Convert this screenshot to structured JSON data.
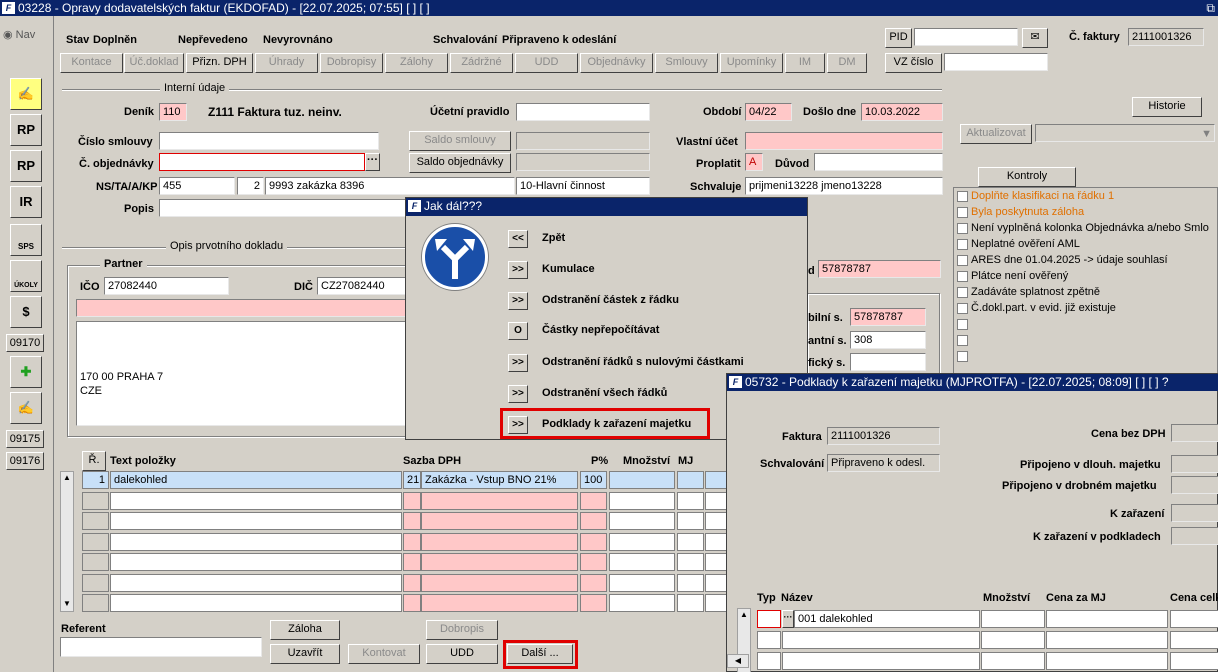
{
  "main_window": {
    "title": "03228 - Opravy dodavatelských faktur (EKDOFAD) - [22.07.2025; 07:55]  [ ]  [ ]",
    "restore_icon": "restore-icon"
  },
  "sidebar": {
    "nav_label": "Nav",
    "buttons": [
      {
        "label": "RP"
      },
      {
        "label": "RP"
      },
      {
        "label": "IR"
      },
      {
        "label": "SPS"
      },
      {
        "label": "ÚKOLY"
      },
      {
        "label": "09170"
      },
      {
        "label": "09175"
      },
      {
        "label": "09176"
      }
    ]
  },
  "status": {
    "stav_label": "Stav",
    "stav_value": "Doplněn",
    "prenes": "Nepřevedeno",
    "vyrovnano": "Nevyrovnáno",
    "schval_label": "Schvalování",
    "schval_value": "Připraveno k odeslání"
  },
  "tabs": [
    "Kontace",
    "Úč.doklad",
    "Přizn. DPH",
    "Úhrady",
    "Dobropisy",
    "Zálohy",
    "Zádržné",
    "UDD",
    "Objednávky",
    "Smlouvy",
    "Upomínky",
    "IM",
    "DM"
  ],
  "pid": {
    "label": "PID",
    "value": "",
    "vz_label": "VZ číslo",
    "vz_value": ""
  },
  "faktura": {
    "label": "Č. faktury",
    "value": "2111001326"
  },
  "internal": {
    "section": "Interní údaje",
    "denik_label": "Deník",
    "denik_value": "110",
    "denik_name": "Z111 Faktura tuz. neinv.",
    "ucet_label": "Účetní pravidlo",
    "ucet_value": "",
    "obdobi_label": "Období",
    "obdobi_value": "04/22",
    "doslo_label": "Došlo dne",
    "doslo_value": "10.03.2022",
    "historie": "Historie",
    "smlouva_label": "Číslo smlouvy",
    "smlouva_value": "",
    "saldo_smlouvy": "Saldo smlouvy",
    "vlastni_label": "Vlastní účet",
    "vlastni_value": "",
    "aktualizovat": "Aktualizovat",
    "obj_label": "Č. objednávky",
    "obj_value": "",
    "saldo_obj": "Saldo objednávky",
    "proplatit_label": "Proplatit",
    "proplatit_value": "A",
    "duvod_label": "Důvod",
    "duvod_value": "",
    "ns_label": "NS/TA/A/KP",
    "ns_value": "455",
    "ta_value": "2",
    "a_value": "9993 zakázka 8396",
    "kp_value": "10-Hlavní činnost",
    "schvaluje_label": "Schvaluje",
    "schvaluje_value": "prijmeni13228 jmeno13228",
    "popis_label": "Popis",
    "popis_value": ""
  },
  "kontroly": {
    "tab": "Kontroly",
    "items": [
      {
        "text": "Doplňte klasifikaci na řádku 1",
        "color": "#e07000"
      },
      {
        "text": "Byla poskytnuta záloha",
        "color": "#e07000"
      },
      {
        "text": "Není vyplněná kolonka Objednávka a/nebo Smlo",
        "color": "#000000"
      },
      {
        "text": "Neplatné ověření AML",
        "color": "#000000"
      },
      {
        "text": "ARES dne 01.04.2025 -> údaje souhlasí",
        "color": "#000000"
      },
      {
        "text": "Plátce není ověřený",
        "color": "#000000"
      },
      {
        "text": "Zadáváte splatnost zpětně",
        "color": "#000000"
      },
      {
        "text": "Č.dokl.part. v evid. již existuje",
        "color": "#000000"
      }
    ]
  },
  "opis": {
    "section": "Opis prvotního dokladu",
    "partner": "Partner",
    "ico_label": "IČO",
    "ico_value": "27082440",
    "dic_label": "DIČ",
    "dic_value": "CZ27082440",
    "addr_line1": "170 00 PRAHA 7",
    "addr_line2": "CZE",
    "vs_label": "d",
    "vs_value": "57878787",
    "ks_label": "bilní s.",
    "ks_value": "57878787",
    "kon_label": "antní s.",
    "kon_value": "308",
    "spec_label": "fický s.",
    "spec_value": ""
  },
  "items_table": {
    "headers": {
      "r": "Ř.",
      "text": "Text položky",
      "sazba": "Sazba DPH",
      "pct": "P%",
      "mnozstvi": "Množství",
      "mj": "MJ"
    },
    "rows": [
      {
        "r": "1",
        "text": "dalekohled",
        "sazba_code": "21",
        "sazba_text": "Zakázka - Vstup BNO 21%",
        "pct": "100",
        "mnozstvi": "",
        "mj": ""
      }
    ]
  },
  "bottom": {
    "referent_label": "Referent",
    "referent_value": "",
    "zaloha": "Záloha",
    "dobropis": "Dobropis",
    "uzavrit": "Uzavřít",
    "kontovat": "Kontovat",
    "udd": "UDD",
    "dalsi": "Další ..."
  },
  "dialog": {
    "title": "Jak dál???",
    "icon": "fork-arrow-sign-icon",
    "options": [
      {
        "btn": "<<",
        "label": "Zpět"
      },
      {
        "btn": ">>",
        "label": "Kumulace"
      },
      {
        "btn": ">>",
        "label": "Odstranění částek z řádku"
      },
      {
        "btn": "O",
        "label": "Částky nepřepočítávat"
      },
      {
        "btn": ">>",
        "label": "Odstranění řádků s nulovými částkami"
      },
      {
        "btn": ">>",
        "label": "Odstranění všech řádků"
      },
      {
        "btn": ">>",
        "label": "Podklady k zařazení majetku"
      }
    ]
  },
  "sub_window": {
    "title": "05732 - Podklady k zařazení majetku (MJPROTFA) - [22.07.2025; 08:09]  [ ]  [ ]  ?",
    "faktura_label": "Faktura",
    "faktura_value": "2111001326",
    "schval_label": "Schvalování",
    "schval_value": "Připraveno k odesl.",
    "cena_bez_label": "Cena bez DPH",
    "dlouh_label": "Připojeno v dlouh. majetku",
    "drob_label": "Připojeno v drobném majetku",
    "kzar_label": "K zařazení",
    "kzarp_label": "K zařazení v podkladech",
    "headers": {
      "typ": "Typ",
      "nazev": "Název",
      "mnozstvi": "Množství",
      "cena_mj": "Cena za MJ",
      "cena_cel": "Cena celk"
    },
    "rows": [
      {
        "typ": "",
        "nazev": "001 dalekohled"
      }
    ]
  }
}
